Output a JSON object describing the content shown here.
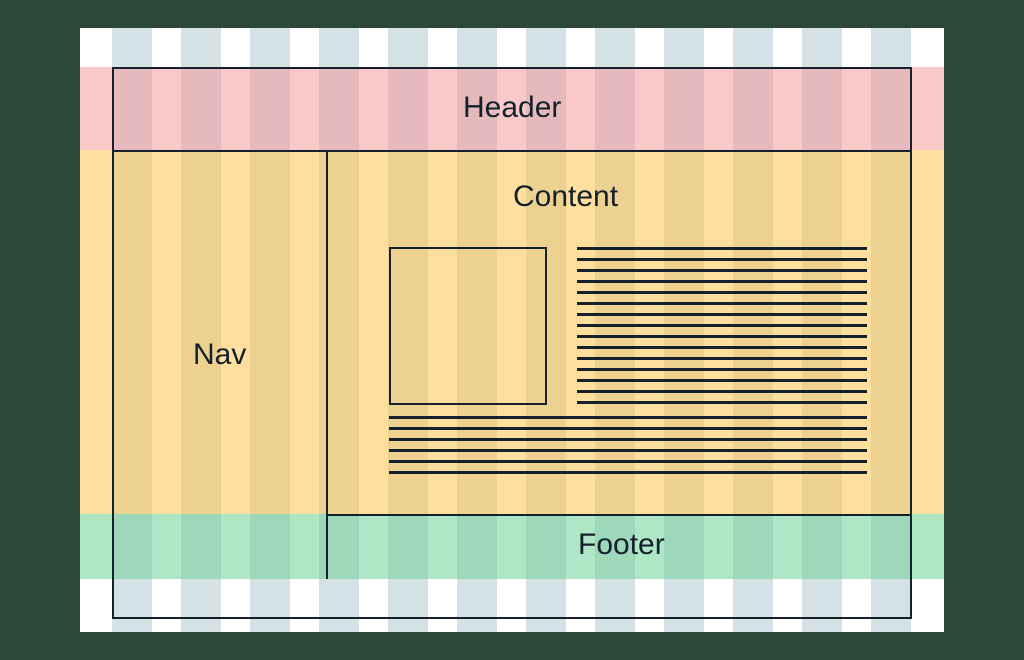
{
  "layout": {
    "header": "Header",
    "nav": "Nav",
    "content": "Content",
    "footer": "Footer"
  },
  "columns": 12,
  "bands": {
    "header_color": "#f49b9b",
    "body_color": "#ffc44d",
    "footer_color": "#6ed296"
  }
}
